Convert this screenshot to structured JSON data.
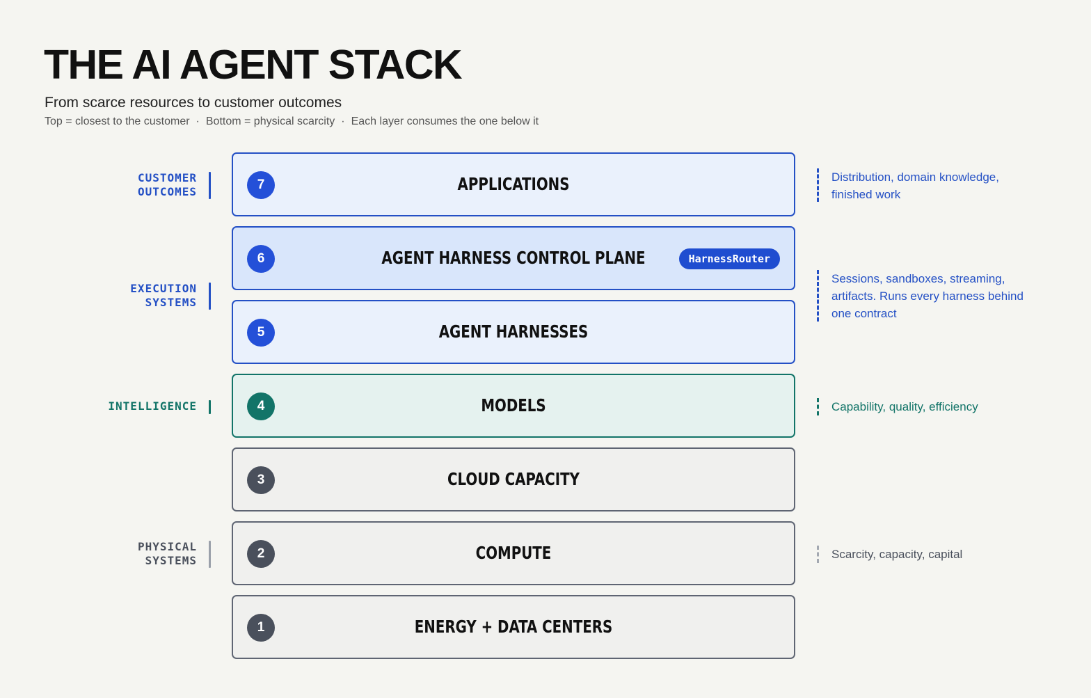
{
  "header": {
    "title": "THE AI AGENT STACK",
    "subtitle": "From scarce resources to customer outcomes",
    "caption_parts": [
      "Top = closest to the customer",
      "Bottom = physical scarcity",
      "Each layer consumes the one below it"
    ],
    "caption_separator": "·"
  },
  "groups": [
    {
      "lines": [
        "CUSTOMER",
        "OUTCOMES"
      ],
      "color": "#2450c5"
    },
    {
      "lines": [
        "EXECUTION",
        "SYSTEMS"
      ],
      "color": "#2450c5"
    },
    {
      "lines": [
        "INTELLIGENCE"
      ],
      "color": "#127468"
    },
    {
      "lines": [
        "PHYSICAL",
        "SYSTEMS"
      ],
      "color": "#4a505c"
    }
  ],
  "layers": [
    {
      "number": "7",
      "name": "APPLICATIONS"
    },
    {
      "number": "6",
      "name": "AGENT HARNESS CONTROL PLANE",
      "badge": "HarnessRouter"
    },
    {
      "number": "5",
      "name": "AGENT HARNESSES"
    },
    {
      "number": "4",
      "name": "MODELS"
    },
    {
      "number": "3",
      "name": "CLOUD CAPACITY"
    },
    {
      "number": "2",
      "name": "COMPUTE"
    },
    {
      "number": "1",
      "name": "ENERGY + DATA CENTERS"
    }
  ],
  "notes": [
    {
      "lines": [
        "Distribution, domain knowledge,",
        "finished work"
      ],
      "color": "#2450c5"
    },
    {
      "lines": [
        "Sessions, sandboxes, streaming,",
        "artifacts. Runs every harness behind",
        "one contract"
      ],
      "color": "#2450c5"
    },
    {
      "lines": [
        "Capability, quality, efficiency"
      ],
      "color": "#127468"
    },
    {
      "lines": [
        "Scarcity, capacity, capital"
      ],
      "color": "#4a505c"
    }
  ],
  "colors": {
    "blue_accent": "#2450c5",
    "teal_accent": "#127468",
    "gray_accent": "#5f6573",
    "background": "#f5f5f1"
  }
}
